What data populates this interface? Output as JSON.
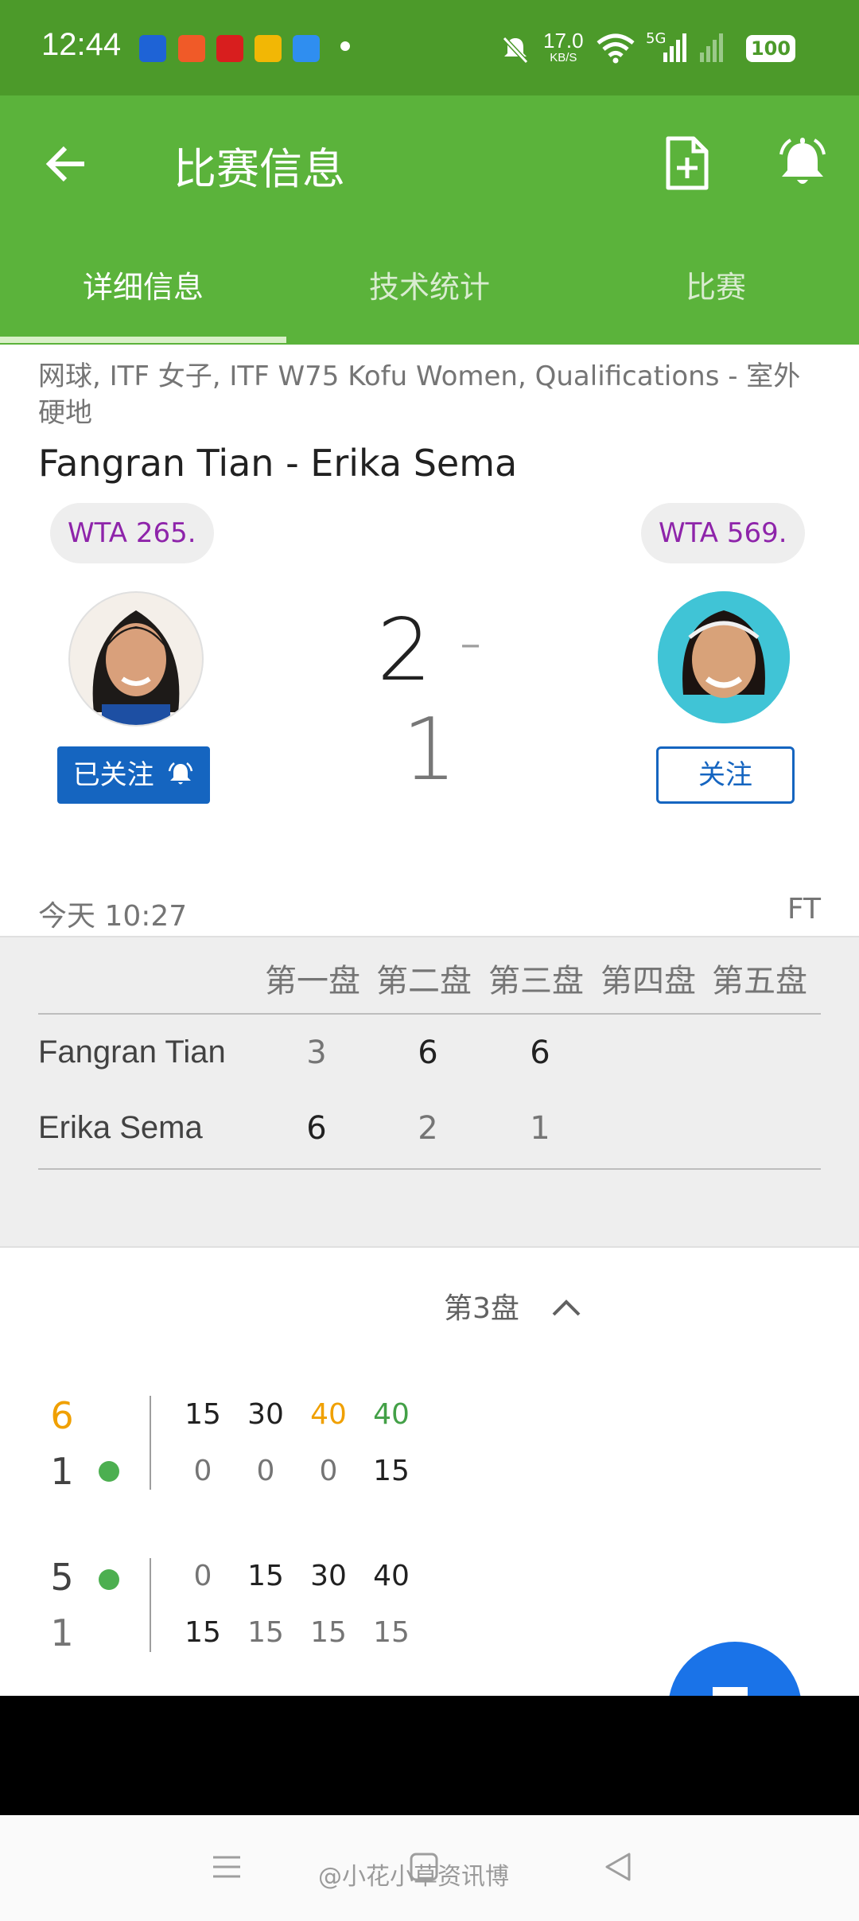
{
  "status_bar": {
    "time": "12:44",
    "net_speed_value": "17.0",
    "net_speed_unit": "KB/S",
    "network": "5G",
    "battery": "100",
    "app_icons": [
      "news-app-icon",
      "music-app-icon",
      "shop-app-icon",
      "weibo-icon",
      "browser-icon"
    ]
  },
  "toolbar": {
    "title": "比赛信息",
    "back_icon": "arrow-left-icon",
    "actions": [
      "add-note-icon",
      "bell-icon"
    ]
  },
  "tabs": [
    {
      "label": "详细信息",
      "active": true
    },
    {
      "label": "技术统计",
      "active": false
    },
    {
      "label": "比赛",
      "active": false
    }
  ],
  "match": {
    "competition": "网球, ITF 女子, ITF W75 Kofu Women, Qualifications - 室外硬地",
    "name": "Fangran Tian - Erika Sema",
    "left_player": {
      "rank": "WTA 265.",
      "follow_label": "已关注",
      "followed": true
    },
    "right_player": {
      "rank": "WTA 569.",
      "follow_label": "关注",
      "followed": false
    },
    "score_left": "2",
    "score_sep": "-",
    "score_right": "1",
    "datetime": "今天 10:27",
    "status": "FT"
  },
  "sets_table": {
    "headers": [
      "第一盘",
      "第二盘",
      "第三盘",
      "第四盘",
      "第五盘"
    ],
    "rows": [
      {
        "player": "Fangran Tian",
        "scores": [
          "3",
          "6",
          "6"
        ]
      },
      {
        "player": "Erika Sema",
        "scores": [
          "6",
          "2",
          "1"
        ]
      }
    ]
  },
  "set_section": {
    "label": "第3盘",
    "games": [
      {
        "top_games": "6",
        "bottom_games": "1",
        "server": "bottom",
        "top_points": [
          "15",
          "30",
          "40",
          "40"
        ],
        "bottom_points": [
          "0",
          "0",
          "0",
          "15"
        ]
      },
      {
        "top_games": "5",
        "bottom_games": "1",
        "server": "top",
        "top_points": [
          "0",
          "15",
          "30",
          "40"
        ],
        "bottom_points": [
          "15",
          "15",
          "15",
          "15"
        ]
      }
    ]
  },
  "colors": {
    "toolbar": "#5bb33b",
    "statusbar": "#4c9a2a",
    "accent_blue": "#1565c0",
    "rank_purple": "#8e24aa",
    "serve_green": "#4caf50",
    "point_orange": "#f0a000"
  },
  "watermark": "@小花小草资讯博"
}
